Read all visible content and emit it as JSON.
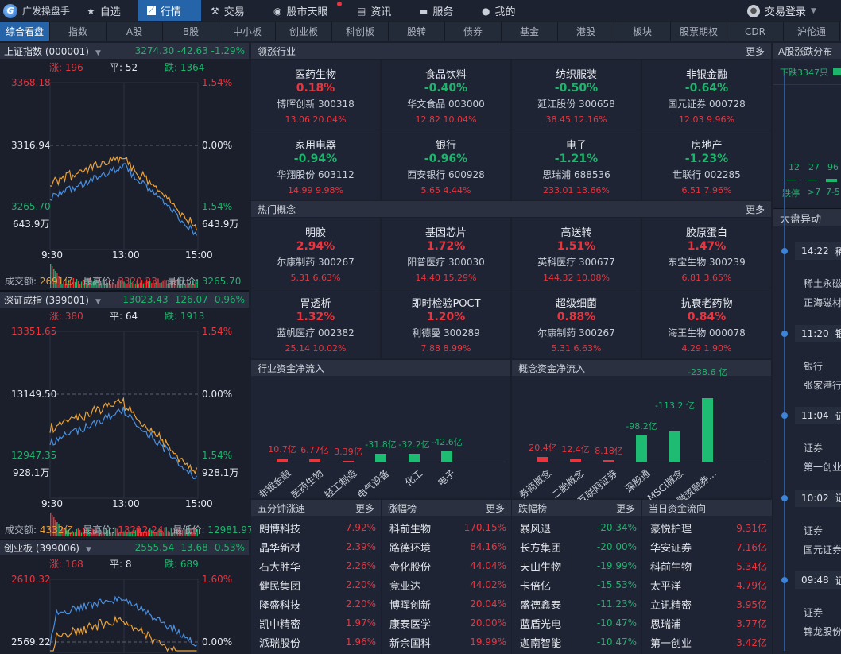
{
  "app": {
    "title": "广发操盘手"
  },
  "nav": [
    {
      "label": "自选",
      "icon": "star-icon"
    },
    {
      "label": "行情",
      "icon": "chart-icon",
      "active": true
    },
    {
      "label": "交易",
      "icon": "gavel-icon"
    },
    {
      "label": "股市天眼",
      "icon": "eye-icon",
      "badge": true
    },
    {
      "label": "资讯",
      "icon": "news-icon"
    },
    {
      "label": "服务",
      "icon": "briefcase-icon"
    },
    {
      "label": "我的",
      "icon": "user-icon"
    }
  ],
  "login": {
    "label": "交易登录"
  },
  "subtabs": [
    "综合看盘",
    "指数",
    "A股",
    "B股",
    "中小板",
    "创业板",
    "科创板",
    "股转",
    "债券",
    "基金",
    "港股",
    "板块",
    "股票期权",
    "CDR",
    "沪伦通"
  ],
  "indices": [
    {
      "name": "上证指数 (000001)",
      "quote": "3274.30  -42.63  -1.29%",
      "up": "涨: 196",
      "flat": "平: 52",
      "down": "跌: 1364",
      "hi": "3368.18",
      "mid": "3316.94",
      "lo": "3265.70",
      "pct_hi": "1.54%",
      "pct_mid": "0.00%",
      "pct_lo": "1.54%",
      "vol": "643.9万",
      "t0": "9:30",
      "t1": "13:00",
      "t2": "15:00",
      "amount_label": "成交额: ",
      "amount": "2691亿",
      "high_label": "最高价: ",
      "high": "3320.23",
      "low_label": "最低价: ",
      "low": "3265.70"
    },
    {
      "name": "深证成指 (399001)",
      "quote": "13023.43  -126.07  -0.96%",
      "up": "涨: 380",
      "flat": "平: 64",
      "down": "跌: 1913",
      "hi": "13351.65",
      "mid": "13149.50",
      "lo": "12947.35",
      "pct_hi": "1.54%",
      "pct_mid": "0.00%",
      "pct_lo": "1.54%",
      "vol": "928.1万",
      "t0": "9:30",
      "t1": "13:00",
      "t2": "15:00",
      "amount_label": "成交额: ",
      "amount": "4332亿",
      "high_label": "最高价: ",
      "high": "13212.24",
      "low_label": "最低价: ",
      "low": "12981.97"
    },
    {
      "name": "创业板 (399006)",
      "quote": "2555.54  -13.68  -0.53%",
      "up": "涨: 168",
      "flat": "平: 8",
      "down": "跌: 689",
      "hi": "2610.32",
      "mid": "2569.22",
      "pct_hi": "1.60%",
      "pct_mid": "0.00%"
    }
  ],
  "leading": {
    "title": "领涨行业",
    "more": "更多",
    "tiles": [
      {
        "name": "医药生物",
        "pct": "0.18%",
        "up": true,
        "stock": "博晖创新 300318",
        "quote": "13.06 20.04%"
      },
      {
        "name": "食品饮料",
        "pct": "-0.40%",
        "stock": "华文食品 003000",
        "quote": "12.82 10.04%"
      },
      {
        "name": "纺织服装",
        "pct": "-0.50%",
        "stock": "延江股份 300658",
        "quote": "38.45 12.16%"
      },
      {
        "name": "非银金融",
        "pct": "-0.64%",
        "stock": "国元证券 000728",
        "quote": "12.03 9.96%"
      },
      {
        "name": "家用电器",
        "pct": "-0.94%",
        "stock": "华翔股份 603112",
        "quote": "14.99 9.98%"
      },
      {
        "name": "银行",
        "pct": "-0.96%",
        "stock": "西安银行 600928",
        "quote": "5.65 4.44%"
      },
      {
        "name": "电子",
        "pct": "-1.21%",
        "stock": "思瑞浦 688536",
        "quote": "233.01 13.66%"
      },
      {
        "name": "房地产",
        "pct": "-1.23%",
        "stock": "世联行 002285",
        "quote": "6.51 7.96%"
      }
    ]
  },
  "concepts": {
    "title": "热门概念",
    "more": "更多",
    "tiles": [
      {
        "name": "明胶",
        "pct": "2.94%",
        "up": true,
        "stock": "尔康制药 300267",
        "quote": "5.31 6.63%"
      },
      {
        "name": "基因芯片",
        "pct": "1.72%",
        "up": true,
        "stock": "阳普医疗 300030",
        "quote": "14.40 15.29%"
      },
      {
        "name": "高送转",
        "pct": "1.51%",
        "up": true,
        "stock": "英科医疗 300677",
        "quote": "144.32 10.08%"
      },
      {
        "name": "胶原蛋白",
        "pct": "1.47%",
        "up": true,
        "stock": "东宝生物 300239",
        "quote": "6.81 3.65%"
      },
      {
        "name": "胃透析",
        "pct": "1.32%",
        "up": true,
        "stock": "蓝帆医疗 002382",
        "quote": "25.14 10.02%"
      },
      {
        "name": "即时检验POCT",
        "pct": "1.20%",
        "up": true,
        "stock": "利德曼 300289",
        "quote": "7.88 8.99%"
      },
      {
        "name": "超级细菌",
        "pct": "0.88%",
        "up": true,
        "stock": "尔康制药 300267",
        "quote": "5.31 6.63%"
      },
      {
        "name": "抗衰老药物",
        "pct": "0.84%",
        "up": true,
        "stock": "海王生物 000078",
        "quote": "4.29 1.90%"
      }
    ]
  },
  "flows": [
    {
      "title": "行业资金净流入",
      "items": [
        {
          "cat": "非银金融",
          "value": 10.7,
          "label": "10.7亿"
        },
        {
          "cat": "医药生物",
          "value": 6.77,
          "label": "6.77亿"
        },
        {
          "cat": "轻工制造",
          "value": 3.39,
          "label": "3.39亿"
        },
        {
          "cat": "电气设备",
          "value": -31.8,
          "label": "-31.8亿"
        },
        {
          "cat": "化工",
          "value": -32.2,
          "label": "-32.2亿"
        },
        {
          "cat": "电子",
          "value": -42.6,
          "label": "-42.6亿"
        }
      ]
    },
    {
      "title": "概念资金净流入",
      "items": [
        {
          "cat": "券商概念",
          "value": 20.4,
          "label": "20.4亿"
        },
        {
          "cat": "二胎概念",
          "value": 12.4,
          "label": "12.4亿"
        },
        {
          "cat": "互联网证券",
          "value": 8.18,
          "label": "8.18亿"
        },
        {
          "cat": "深股通",
          "value": -98.2,
          "label": "-98.2亿"
        },
        {
          "cat": "MSCI概念",
          "value": -113.2,
          "label": "-113.2 亿"
        },
        {
          "cat": "融资融券...",
          "value": -238.6,
          "label": "-238.6 亿"
        }
      ]
    }
  ],
  "lists": [
    {
      "title": "五分钟涨速",
      "more": "更多",
      "rows": [
        [
          "朗博科技",
          "7.92%"
        ],
        [
          "晶华新材",
          "2.39%"
        ],
        [
          "石大胜华",
          "2.26%"
        ],
        [
          "健民集团",
          "2.20%"
        ],
        [
          "隆盛科技",
          "2.20%"
        ],
        [
          "凯中精密",
          "1.97%"
        ],
        [
          "派瑞股份",
          "1.96%"
        ]
      ]
    },
    {
      "title": "涨幅榜",
      "more": "更多",
      "rows": [
        [
          "科前生物",
          "170.15%"
        ],
        [
          "路德环境",
          "84.16%"
        ],
        [
          "壶化股份",
          "44.04%"
        ],
        [
          "竞业达",
          "44.02%"
        ],
        [
          "博晖创新",
          "20.04%"
        ],
        [
          "康泰医学",
          "20.00%"
        ],
        [
          "新余国科",
          "19.99%"
        ]
      ]
    },
    {
      "title": "跌幅榜",
      "more": "更多",
      "rows": [
        [
          "暴风退",
          "-20.34%"
        ],
        [
          "长方集团",
          "-20.00%"
        ],
        [
          "天山生物",
          "-19.99%"
        ],
        [
          "卡倍亿",
          "-15.53%"
        ],
        [
          "盛德鑫泰",
          "-11.23%"
        ],
        [
          "蓝盾光电",
          "-10.47%"
        ],
        [
          "迦南智能",
          "-10.47%"
        ]
      ]
    },
    {
      "title": "当日资金流向",
      "more": "",
      "rows": [
        [
          "豪悦护理",
          "9.31亿"
        ],
        [
          "华安证券",
          "7.16亿"
        ],
        [
          "科前生物",
          "5.34亿"
        ],
        [
          "太平洋",
          "4.79亿"
        ],
        [
          "立讯精密",
          "3.95亿"
        ],
        [
          "思瑞浦",
          "3.77亿"
        ],
        [
          "第一创业",
          "3.42亿"
        ]
      ]
    }
  ],
  "distribution": {
    "title": "A股涨跌分布",
    "down_count": "下跌3347只",
    "counts": [
      "12",
      "27",
      "96"
    ],
    "labels": [
      "跌停",
      ">7",
      "7-5"
    ]
  },
  "movers": {
    "title": "大盘异动",
    "events": [
      {
        "time": "14:22",
        "tag": "稀",
        "l1": "稀土永磁",
        "l2": "正海磁材"
      },
      {
        "time": "11:20",
        "tag": "银",
        "l1": "银行",
        "l2": "张家港行"
      },
      {
        "time": "11:04",
        "tag": "证",
        "l1": "证券",
        "l2": "第一创业"
      },
      {
        "time": "10:02",
        "tag": "证",
        "l1": "证券",
        "l2": "国元证券"
      },
      {
        "time": "09:48",
        "tag": "证",
        "l1": "证券",
        "l2": "锦龙股份"
      }
    ]
  },
  "colors": {
    "up": "#e8353e",
    "down": "#1db46c",
    "accent": "#2564a8",
    "bg": "#1a1f2b"
  }
}
